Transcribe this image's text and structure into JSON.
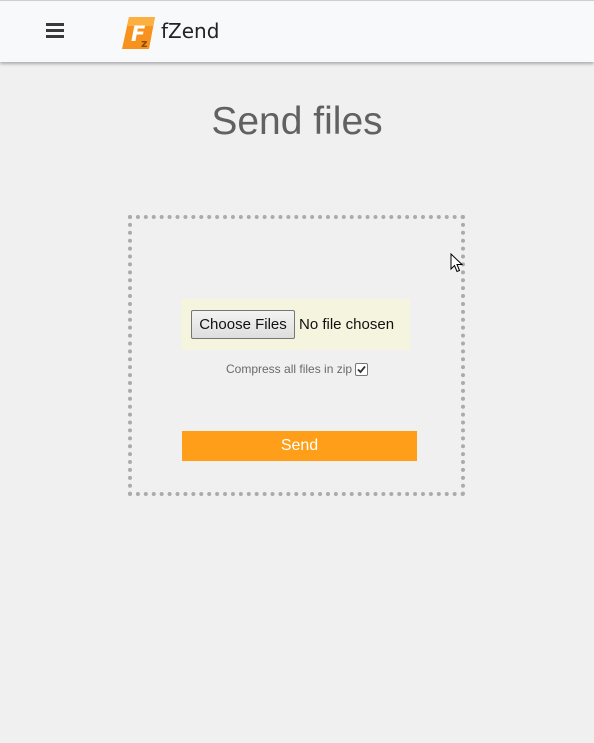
{
  "header": {
    "menu_icon": "hamburger-icon",
    "brand_name": "fZend",
    "logo_icon": "fzend-logo",
    "logo_color": "#f7921e"
  },
  "main": {
    "title": "Send files",
    "file_input": {
      "button_label": "Choose Files",
      "status": "No file chosen"
    },
    "compress": {
      "label": "Compress all files in zip",
      "checked": true
    },
    "send_label": "Send"
  },
  "colors": {
    "accent": "#ff9f19",
    "background": "#f0f0f0",
    "dropzone_border": "#ababab",
    "file_area_bg": "#f5f4de"
  }
}
